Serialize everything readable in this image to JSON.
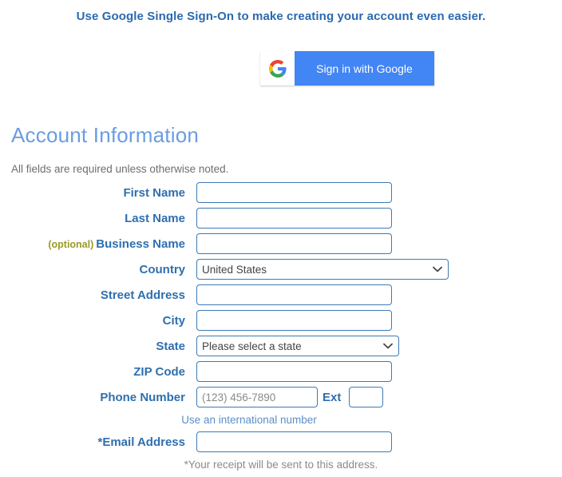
{
  "header": {
    "sso_headline": "Use Google Single Sign-On to make creating your account even easier.",
    "google_button_label": "Sign in with Google",
    "google_icon": "google-g-icon"
  },
  "section": {
    "title": "Account Information",
    "subtitle": "All fields are required unless otherwise noted."
  },
  "form": {
    "fields": [
      {
        "label": "First Name",
        "value": "",
        "placeholder": ""
      },
      {
        "label": "Last Name",
        "value": "",
        "placeholder": ""
      },
      {
        "optional_tag": "(optional)",
        "label": "Business Name",
        "value": "",
        "placeholder": ""
      },
      {
        "label": "Country",
        "selected": "United States"
      },
      {
        "label": "Street Address",
        "value": "",
        "placeholder": ""
      },
      {
        "label": "City",
        "value": "",
        "placeholder": ""
      },
      {
        "label": "State",
        "selected": "Please select a state"
      },
      {
        "label": "ZIP Code",
        "value": "",
        "placeholder": ""
      },
      {
        "label": "Phone Number",
        "value": "",
        "placeholder": "(123) 456-7890"
      },
      {
        "label": "*Email Address",
        "value": "",
        "placeholder": ""
      }
    ],
    "ext_label": "Ext",
    "ext_value": "",
    "international_link": "Use an international number",
    "email_note": "*Your receipt will be sent to this address."
  },
  "colors": {
    "label_blue": "#2e6fb0",
    "heading_blue": "#6a9de0",
    "headline_blue": "#2a6ab0",
    "optional_olive": "#9a9a28",
    "border_blue": "#3d7ab5",
    "google_blue": "#4285f4",
    "helper_gray": "#7d7d7d"
  }
}
